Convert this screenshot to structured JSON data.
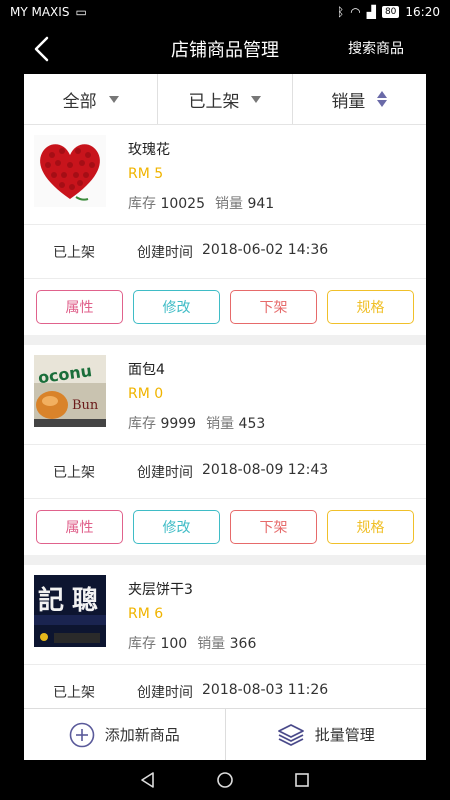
{
  "status_bar": {
    "carrier": "MY MAXIS",
    "battery": "80",
    "time": "16:20"
  },
  "header": {
    "title": "店铺商品管理",
    "search_label": "搜索商品"
  },
  "filters": [
    {
      "label": "全部"
    },
    {
      "label": "已上架"
    },
    {
      "label": "销量"
    }
  ],
  "labels": {
    "stock": "库存",
    "sales": "销量",
    "created": "创建时间"
  },
  "actions": {
    "attr": "属性",
    "edit": "修改",
    "off": "下架",
    "spec": "规格"
  },
  "products": [
    {
      "name": "玫瑰花",
      "price": "RM 5",
      "stock": "10025",
      "sales": "941",
      "status": "已上架",
      "created": "2018-06-02 14:36"
    },
    {
      "name": "面包4",
      "price": "RM 0",
      "stock": "9999",
      "sales": "453",
      "status": "已上架",
      "created": "2018-08-09 12:43"
    },
    {
      "name": "夹层饼干3",
      "price": "RM 6",
      "stock": "100",
      "sales": "366",
      "status": "已上架",
      "created": "2018-08-03 11:26"
    }
  ],
  "bottom": {
    "add_label": "添加新商品",
    "batch_label": "批量管理"
  },
  "colors": {
    "price": "#f0b400",
    "attr": "#e0628c",
    "edit": "#3fbcc6",
    "off": "#e66a6a",
    "spec": "#f0c02a"
  }
}
